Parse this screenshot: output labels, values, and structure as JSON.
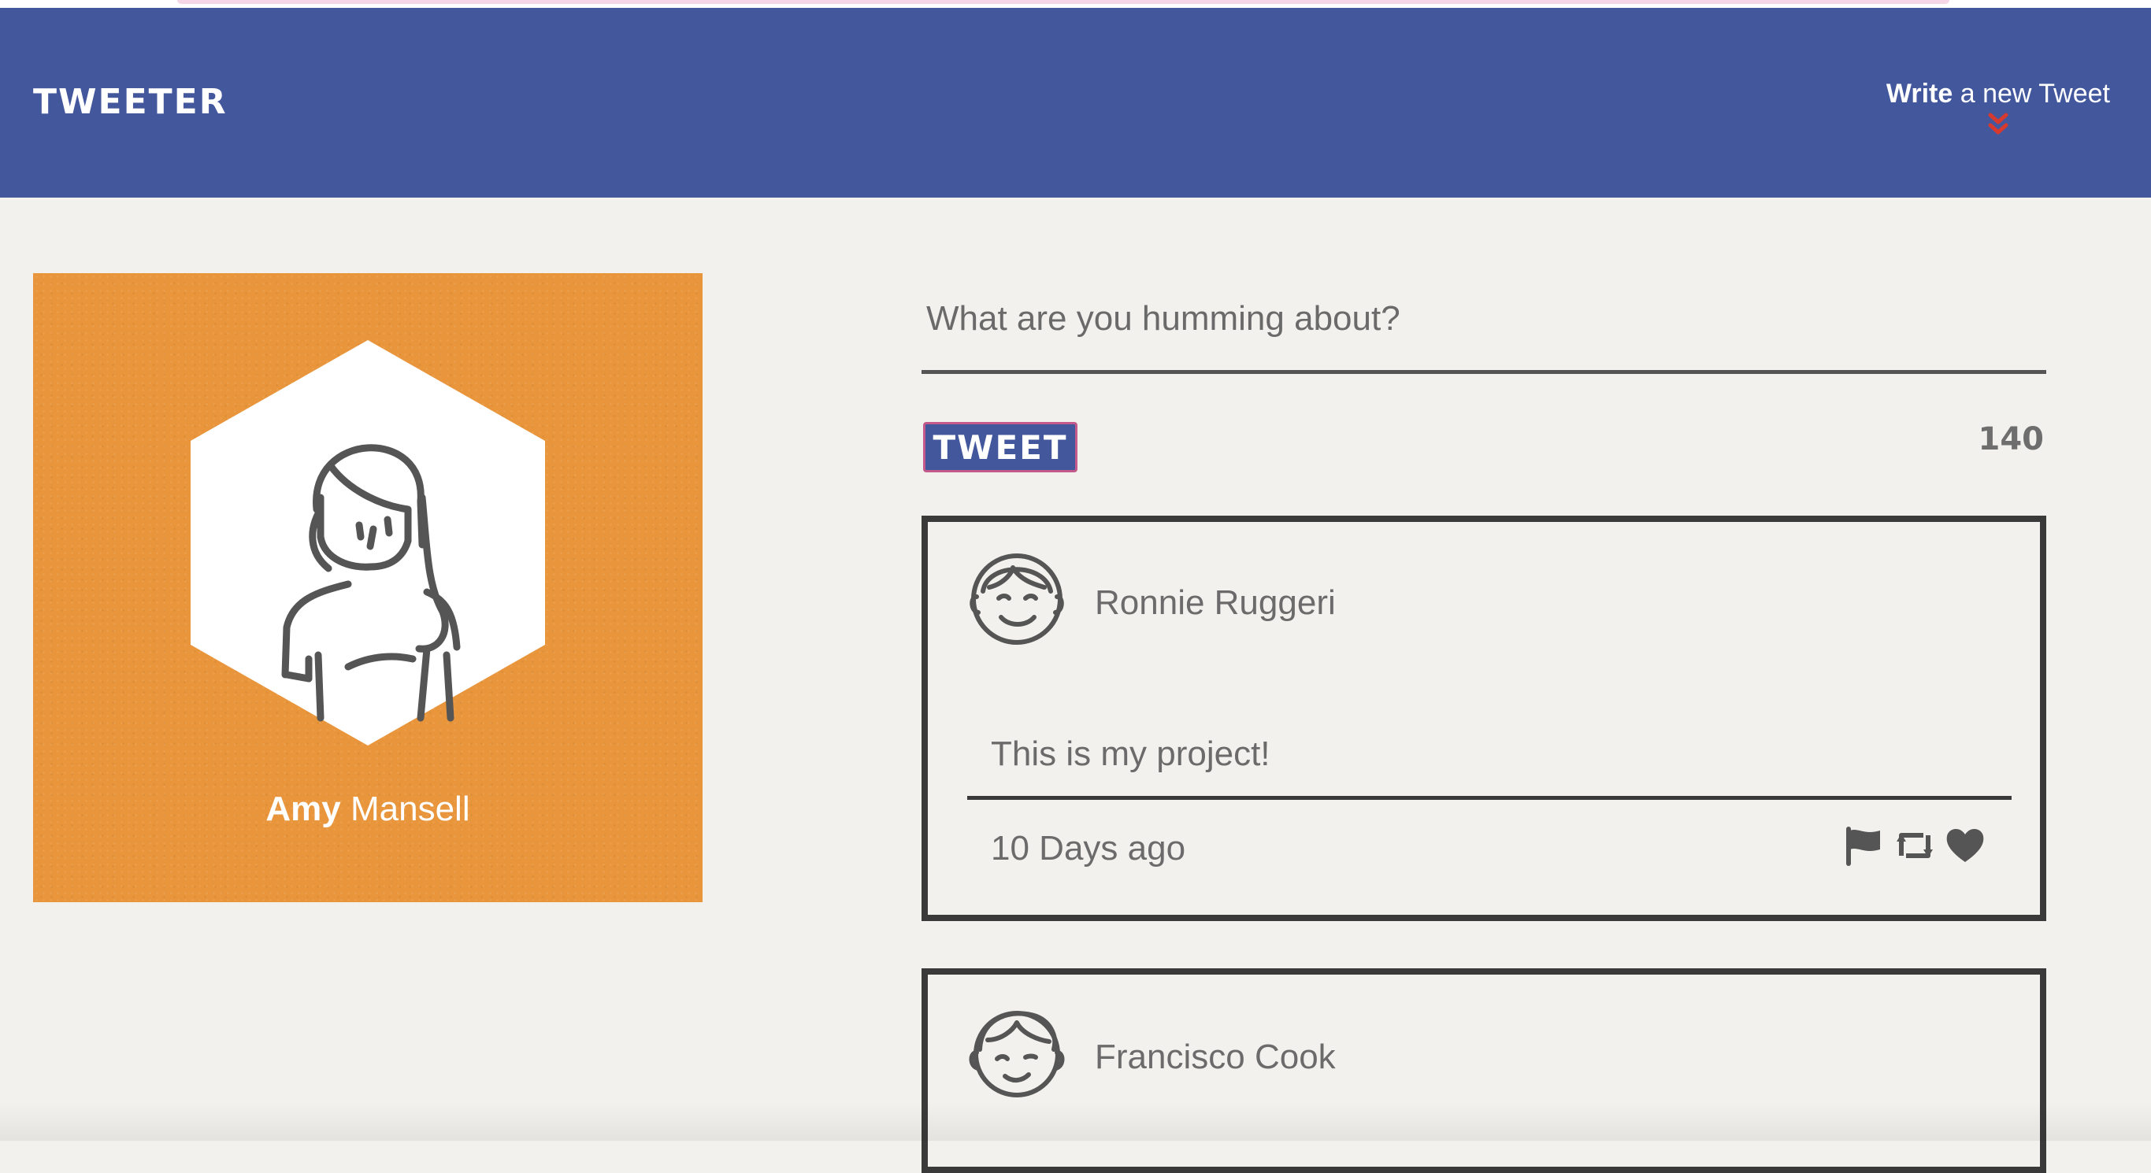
{
  "header": {
    "logo": "TWEETER",
    "write_link": {
      "strong": "Write",
      "rest": " a new Tweet"
    }
  },
  "profile": {
    "first_name": "Amy",
    "last_name": " Mansell",
    "card_color": "#e9953b",
    "avatar_icon": "woman-avatar-icon"
  },
  "compose": {
    "placeholder": "What are you humming about?",
    "button_label": "TWEET",
    "char_count": "140"
  },
  "tweets": [
    {
      "author": "Ronnie Ruggeri",
      "avatar_icon": "man-smiling-avatar-icon",
      "text": "This is my project!",
      "timestamp": "10 Days ago",
      "actions": [
        "flag-icon",
        "retweet-icon",
        "heart-icon"
      ]
    },
    {
      "author": "Francisco Cook",
      "avatar_icon": "man-winking-avatar-icon"
    }
  ],
  "colors": {
    "header": "#43579d",
    "background": "#f3f1ed",
    "chevron": "#d63a2f",
    "text_gray": "#6b6b6b",
    "border_dark": "#3a3a3a"
  }
}
